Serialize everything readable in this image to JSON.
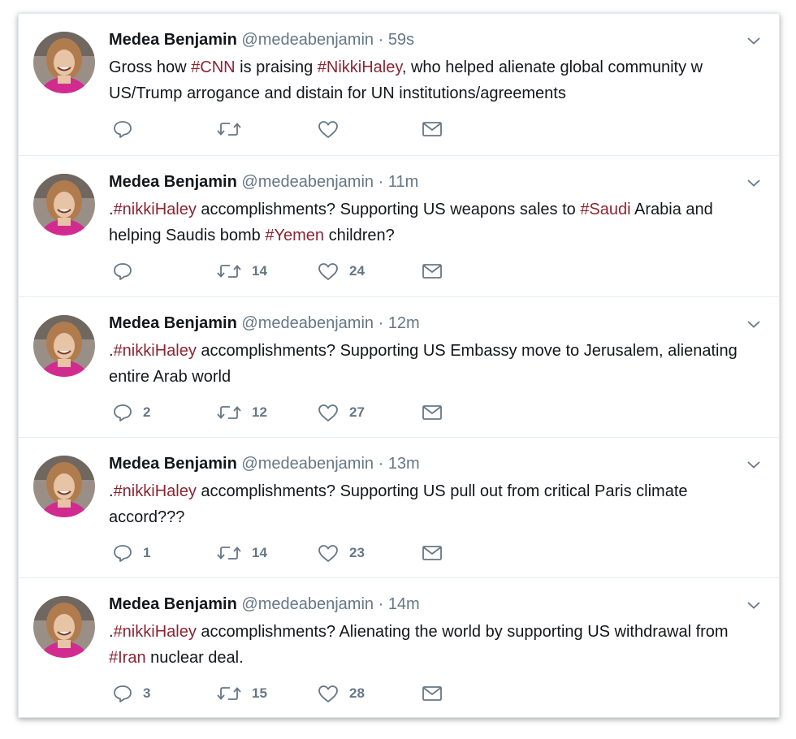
{
  "colors": {
    "hashtag": "#8c2432",
    "muted": "#657786",
    "text": "#14171a"
  },
  "icons": {
    "reply": "reply-icon",
    "retweet": "retweet-icon",
    "like": "heart-icon",
    "dm": "envelope-icon",
    "menu": "chevron-down-icon"
  },
  "tweets": [
    {
      "name": "Medea Benjamin",
      "handle": "@medeabenjamin",
      "sep": "·",
      "time": "59s",
      "segments": [
        {
          "t": "Gross how ",
          "h": false
        },
        {
          "t": "#CNN",
          "h": true
        },
        {
          "t": " is praising ",
          "h": false
        },
        {
          "t": "#NikkiHaley",
          "h": true
        },
        {
          "t": ", who helped alienate global community w US/Trump arrogance and distain for UN institutions/agreements",
          "h": false
        }
      ],
      "replies": "",
      "retweets": "",
      "likes": ""
    },
    {
      "name": "Medea Benjamin",
      "handle": "@medeabenjamin",
      "sep": "·",
      "time": "11m",
      "segments": [
        {
          "t": ".",
          "h": false
        },
        {
          "t": "#nikkiHaley",
          "h": true
        },
        {
          "t": " accomplishments? Supporting US weapons sales to ",
          "h": false
        },
        {
          "t": "#Saudi",
          "h": true
        },
        {
          "t": " Arabia and helping Saudis bomb ",
          "h": false
        },
        {
          "t": "#Yemen",
          "h": true
        },
        {
          "t": " children?",
          "h": false
        }
      ],
      "replies": "",
      "retweets": "14",
      "likes": "24"
    },
    {
      "name": "Medea Benjamin",
      "handle": "@medeabenjamin",
      "sep": "·",
      "time": "12m",
      "segments": [
        {
          "t": ".",
          "h": false
        },
        {
          "t": "#nikkiHaley",
          "h": true
        },
        {
          "t": " accomplishments? Supporting US Embassy move to Jerusalem, alienating entire Arab world",
          "h": false
        }
      ],
      "replies": "2",
      "retweets": "12",
      "likes": "27"
    },
    {
      "name": "Medea Benjamin",
      "handle": "@medeabenjamin",
      "sep": "·",
      "time": "13m",
      "segments": [
        {
          "t": ".",
          "h": false
        },
        {
          "t": "#nikkiHaley",
          "h": true
        },
        {
          "t": " accomplishments? Supporting US pull out from critical Paris climate accord???",
          "h": false
        }
      ],
      "replies": "1",
      "retweets": "14",
      "likes": "23"
    },
    {
      "name": "Medea Benjamin",
      "handle": "@medeabenjamin",
      "sep": "·",
      "time": "14m",
      "segments": [
        {
          "t": ".",
          "h": false
        },
        {
          "t": "#nikkiHaley",
          "h": true
        },
        {
          "t": " accomplishments? Alienating the world by supporting US withdrawal from ",
          "h": false
        },
        {
          "t": "#Iran",
          "h": true
        },
        {
          "t": " nuclear deal.",
          "h": false
        }
      ],
      "replies": "3",
      "retweets": "15",
      "likes": "28"
    }
  ]
}
